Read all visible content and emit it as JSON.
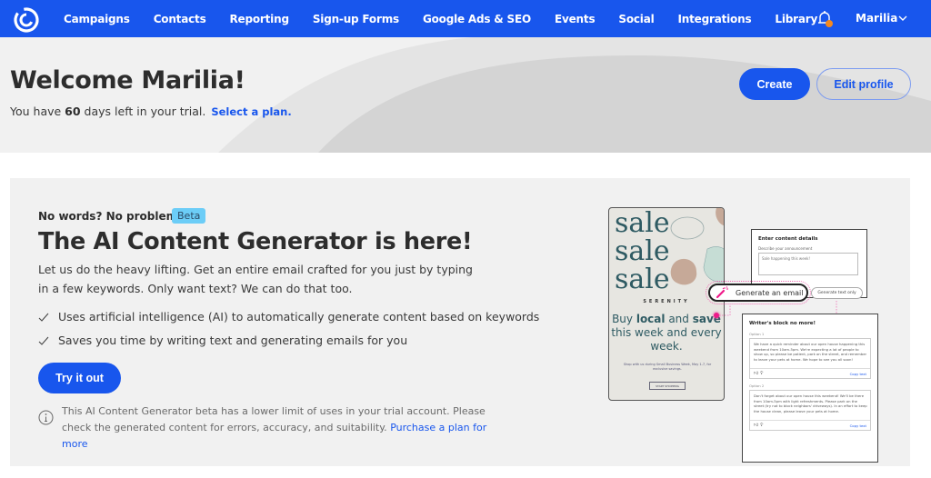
{
  "nav": {
    "logo": "constant-contact-logo-icon",
    "items": [
      "Campaigns",
      "Contacts",
      "Reporting",
      "Sign-up Forms",
      "Google Ads & SEO",
      "Events",
      "Social",
      "Integrations",
      "Library"
    ],
    "notification_icon": "bell-icon",
    "notification_badge_color": "#f5891f",
    "user_name": "Marilia",
    "brand_color": "#1856ed"
  },
  "hero": {
    "title": "Welcome Marilia!",
    "trial_prefix": "You have ",
    "trial_days": "60",
    "trial_suffix": " days left in your trial.",
    "select_plan_link": "Select a plan.",
    "create_button": "Create",
    "edit_profile_button": "Edit profile"
  },
  "promo": {
    "eyebrow": "No words? No problem.",
    "badge": "Beta",
    "headline": "The AI Content Generator is here!",
    "description": "Let us do the heavy lifting. Get an entire email crafted for you just by typing in a few keywords. Only want text? We can do that too.",
    "bullets": [
      "Uses artificial intelligence (AI) to automatically generate content based on keywords",
      "Saves you time by writing text and generating emails for you"
    ],
    "try_button": "Try it out",
    "note": "This AI Content Generator beta has a lower limit of uses in your trial account. Please check the generated content for errors, accuracy, and suitability.",
    "note_link": "Purchase a plan for more"
  },
  "illustration": {
    "poster": {
      "sale_words": [
        "sale",
        "sale",
        "sale"
      ],
      "brand": "SERENITY",
      "headline_parts": [
        "Buy ",
        "local",
        " and ",
        "save",
        " this week and every week."
      ],
      "small_text": "Shop with us during Small Business Week, May 1-7, for exclusive savings.",
      "button": "START SHOPPING"
    },
    "details_panel": {
      "title": "Enter content details",
      "label": "Describe your announcement",
      "input_value": "Sale happening this week!"
    },
    "generate_email_button": "Generate an email",
    "generate_text_button": "Generate text only",
    "results_panel": {
      "title": "Writer's block no more!",
      "options": [
        {
          "label": "Option 1",
          "text": "We have a quick reminder about our open house happening this weekend from 10am-5pm. We're expecting a lot of people to show up, so please be patient, park on the street, and remember to leave your pets at home. We hope to see you all soon!",
          "copy": "Copy text"
        },
        {
          "label": "Option 2",
          "text": "Don't forget about our open house this weekend! We'll be there from 10am-5pm with light refreshments. Please park on the street (try not to block neighbors' driveways). In an effort to keep the house clean, please leave your pets at home.",
          "copy": "Copy text"
        }
      ]
    }
  }
}
